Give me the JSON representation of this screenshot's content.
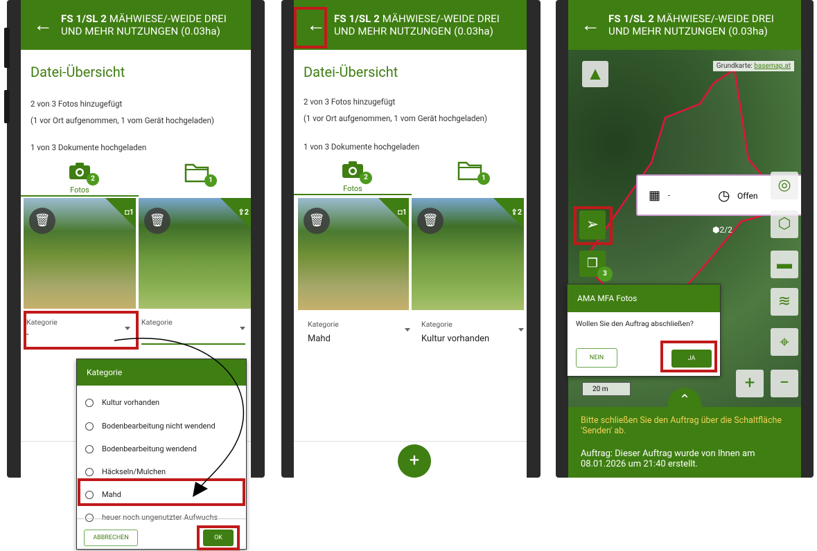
{
  "header": {
    "title_bold": "FS 1/SL 2",
    "title_rest_line1": " MÄHWIESE/-WEIDE DREI",
    "title_line2": "UND MEHR NUTZUNGEN (0.03ha)"
  },
  "overview": {
    "title": "Datei-Übersicht",
    "photos_added": "2 von 3 Fotos hinzugefügt",
    "photos_detail": "(1 vor Ort aufgenommen, 1 vom Gerät hochgeladen)",
    "docs_uploaded": "1 von 3 Dokumente hochgeladen",
    "tab_photos": "Fotos",
    "photos_badge": "2",
    "docs_badge": "1",
    "photo1_corner": "1",
    "photo2_corner": "2"
  },
  "fields": {
    "label": "Kategorie",
    "screen1_value1": "-",
    "screen2_value1": "Mahd",
    "screen2_value2": "Kultur vorhanden"
  },
  "category_dialog": {
    "title": "Kategorie",
    "options": [
      "Kultur vorhanden",
      "Bodenbearbeitung nicht wendend",
      "Bodenbearbeitung wendend",
      "Häckseln/Mulchen",
      "Mahd",
      "heuer noch ungenutzter Aufwuchs"
    ],
    "cancel": "ABBRECHEN",
    "ok": "OK"
  },
  "map": {
    "basemap_prefix": "Grundkarte: ",
    "basemap_link": "basemap.at",
    "status_text": "Offen",
    "date_placeholder": "-",
    "photos_badge": "3",
    "photo_count": "2/2",
    "scale": "20 m",
    "zoom_in": "+",
    "zoom_out": "−"
  },
  "confirm_dialog": {
    "title": "AMA MFA Fotos",
    "message": "Wollen Sie den Auftrag abschließen?",
    "no": "NEIN",
    "yes": "JA"
  },
  "bottom_sheet": {
    "warning": "Bitte schließen Sie den Auftrag über die Schaltfläche 'Senden' ab.",
    "info": "Auftrag: Dieser Auftrag wurde von Ihnen am 08.01.2026 um 21:40 erstellt."
  },
  "colors": {
    "brand_green": "#3f7e12",
    "highlight_red": "#c01a1a",
    "warning_yellow": "#f3d35b"
  }
}
